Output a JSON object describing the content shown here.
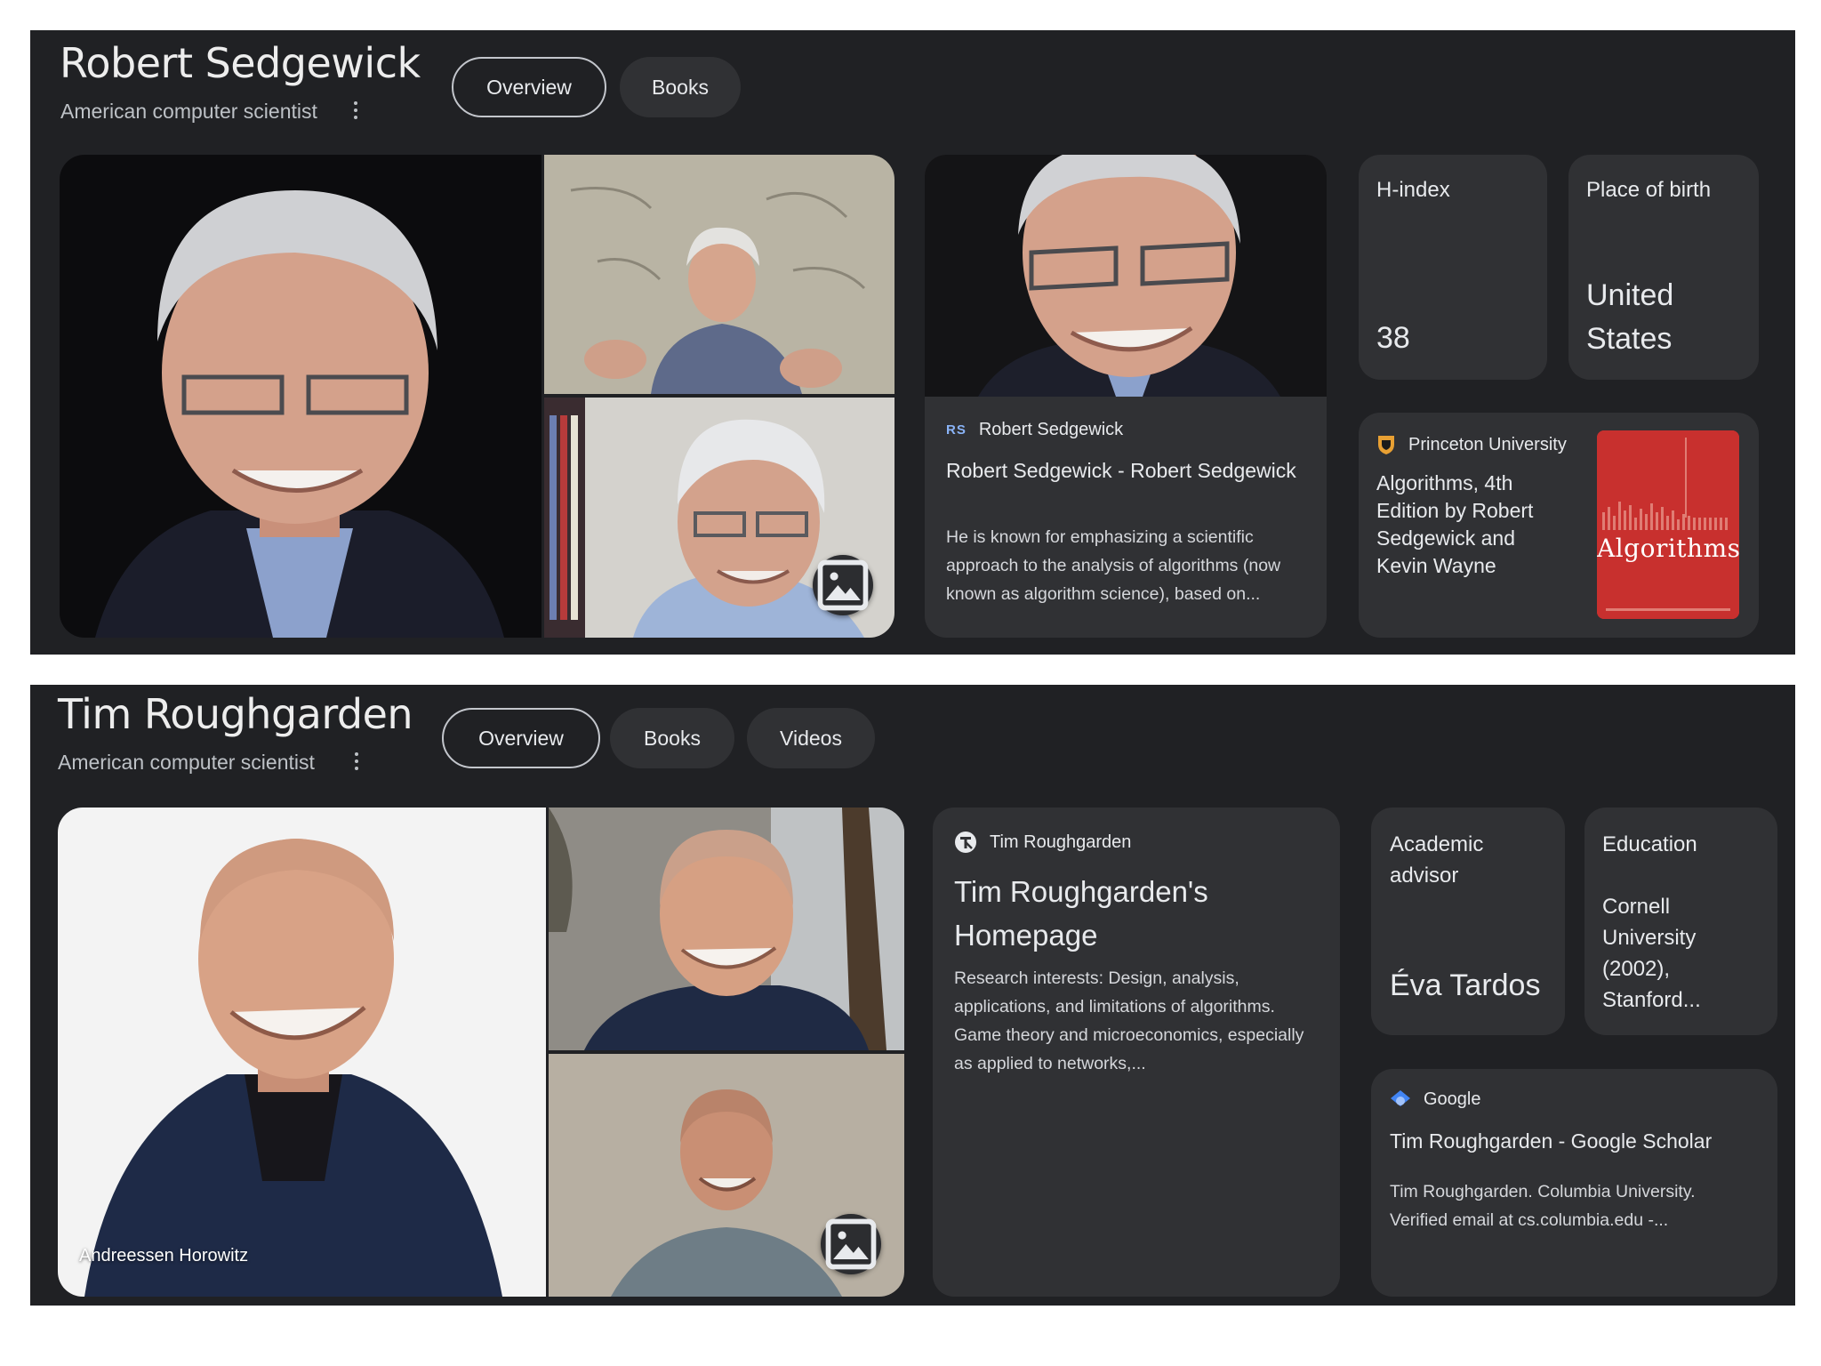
{
  "sedgewick": {
    "title": "Robert Sedgewick",
    "subtitle": "American computer scientist",
    "tabs": [
      "Overview",
      "Books"
    ],
    "web_result": {
      "source_badge": "RS",
      "source": "Robert Sedgewick",
      "title": "Robert Sedgewick - Robert Sedgewick",
      "snippet": "He is known for emphasizing a scientific approach to the analysis of algorithms (now known as algorithm science), based on..."
    },
    "facts": [
      {
        "label": "H-index",
        "value": "38"
      },
      {
        "label": "Place of birth",
        "value": "United States"
      }
    ],
    "book_result": {
      "source": "Princeton University",
      "title": "Algorithms, 4th Edition by Robert Sedgewick and Kevin Wayne",
      "cover_title": "Algorithms"
    }
  },
  "roughgarden": {
    "title": "Tim Roughgarden",
    "subtitle": "American computer scientist",
    "tabs": [
      "Overview",
      "Books",
      "Videos"
    ],
    "main_photo_caption": "Andreessen Horowitz",
    "web_result": {
      "source": "Tim Roughgarden",
      "title": "Tim Roughgarden's Homepage",
      "snippet": "Research interests: Design, analysis, applications, and limitations of algorithms. Game theory and microeconomics, especially as applied to networks,..."
    },
    "facts": [
      {
        "label": "Academic advisor",
        "value": "Éva Tardos"
      },
      {
        "label": "Education",
        "value": "Cornell University (2002), Stanford..."
      }
    ],
    "scholar_result": {
      "source": "Google",
      "title": "Tim Roughgarden - Google Scholar",
      "snippet": "Tim Roughgarden. Columbia University. Verified email at cs.columbia.edu -..."
    }
  }
}
